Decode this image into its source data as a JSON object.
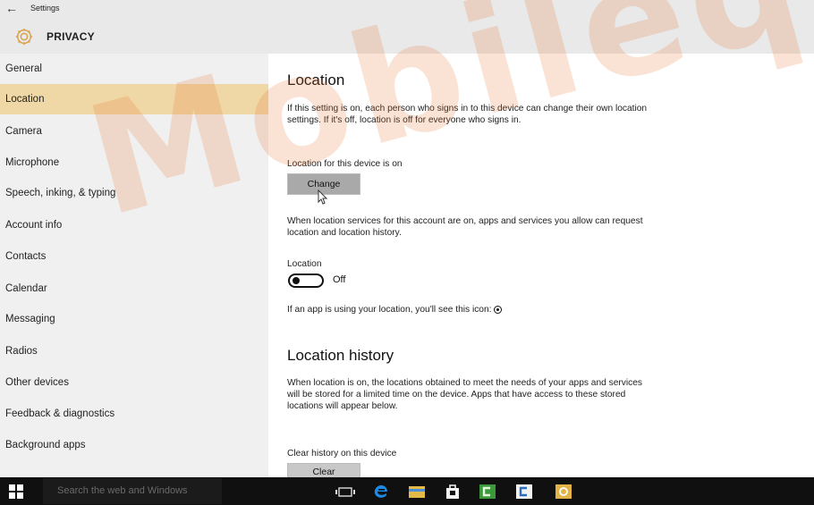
{
  "window": {
    "back_glyph": "←",
    "title": "Settings",
    "section_title": "PRIVACY",
    "section_icon": "gear-icon"
  },
  "sidebar": {
    "items": [
      {
        "label": "General",
        "active": false
      },
      {
        "label": "Location",
        "active": true
      },
      {
        "label": "Camera",
        "active": false
      },
      {
        "label": "Microphone",
        "active": false
      },
      {
        "label": "Speech, inking, & typing",
        "active": false
      },
      {
        "label": "Account info",
        "active": false
      },
      {
        "label": "Contacts",
        "active": false
      },
      {
        "label": "Calendar",
        "active": false
      },
      {
        "label": "Messaging",
        "active": false
      },
      {
        "label": "Radios",
        "active": false
      },
      {
        "label": "Other devices",
        "active": false
      },
      {
        "label": "Feedback & diagnostics",
        "active": false
      },
      {
        "label": "Background apps",
        "active": false
      }
    ]
  },
  "main": {
    "location_heading": "Location",
    "location_description": "If this setting is on, each person who signs in to this device can change their own location settings. If it's off, location is off for everyone who signs in.",
    "device_status": "Location for this device is on",
    "change_button": "Change",
    "services_description": "When location services for this account are on, apps and services you allow can request location and location history.",
    "toggle_label": "Location",
    "toggle_state": "Off",
    "icon_note": "If an app is using your location, you'll see this icon:",
    "history_heading": "Location history",
    "history_description": "When location is on, the locations obtained to meet the needs of your apps and services will be stored for a limited time on the device. Apps that have access to these stored locations will appear below.",
    "clear_label": "Clear history on this device",
    "clear_button": "Clear"
  },
  "watermark": {
    "text": "Mobileq Ac",
    "color": "#e86e28"
  },
  "taskbar": {
    "search_placeholder": "Search the web and Windows",
    "icons": [
      "task-view-icon",
      "edge-icon",
      "file-explorer-icon",
      "store-icon",
      "camtasia-icon",
      "camtasia-recorder-icon",
      "settings-icon"
    ]
  },
  "colors": {
    "accent_selected": "#f0d8a6",
    "sidebar_bg": "#f0f0f0",
    "titlebar_bg": "#e9e9e9",
    "taskbar_bg": "#101010"
  }
}
